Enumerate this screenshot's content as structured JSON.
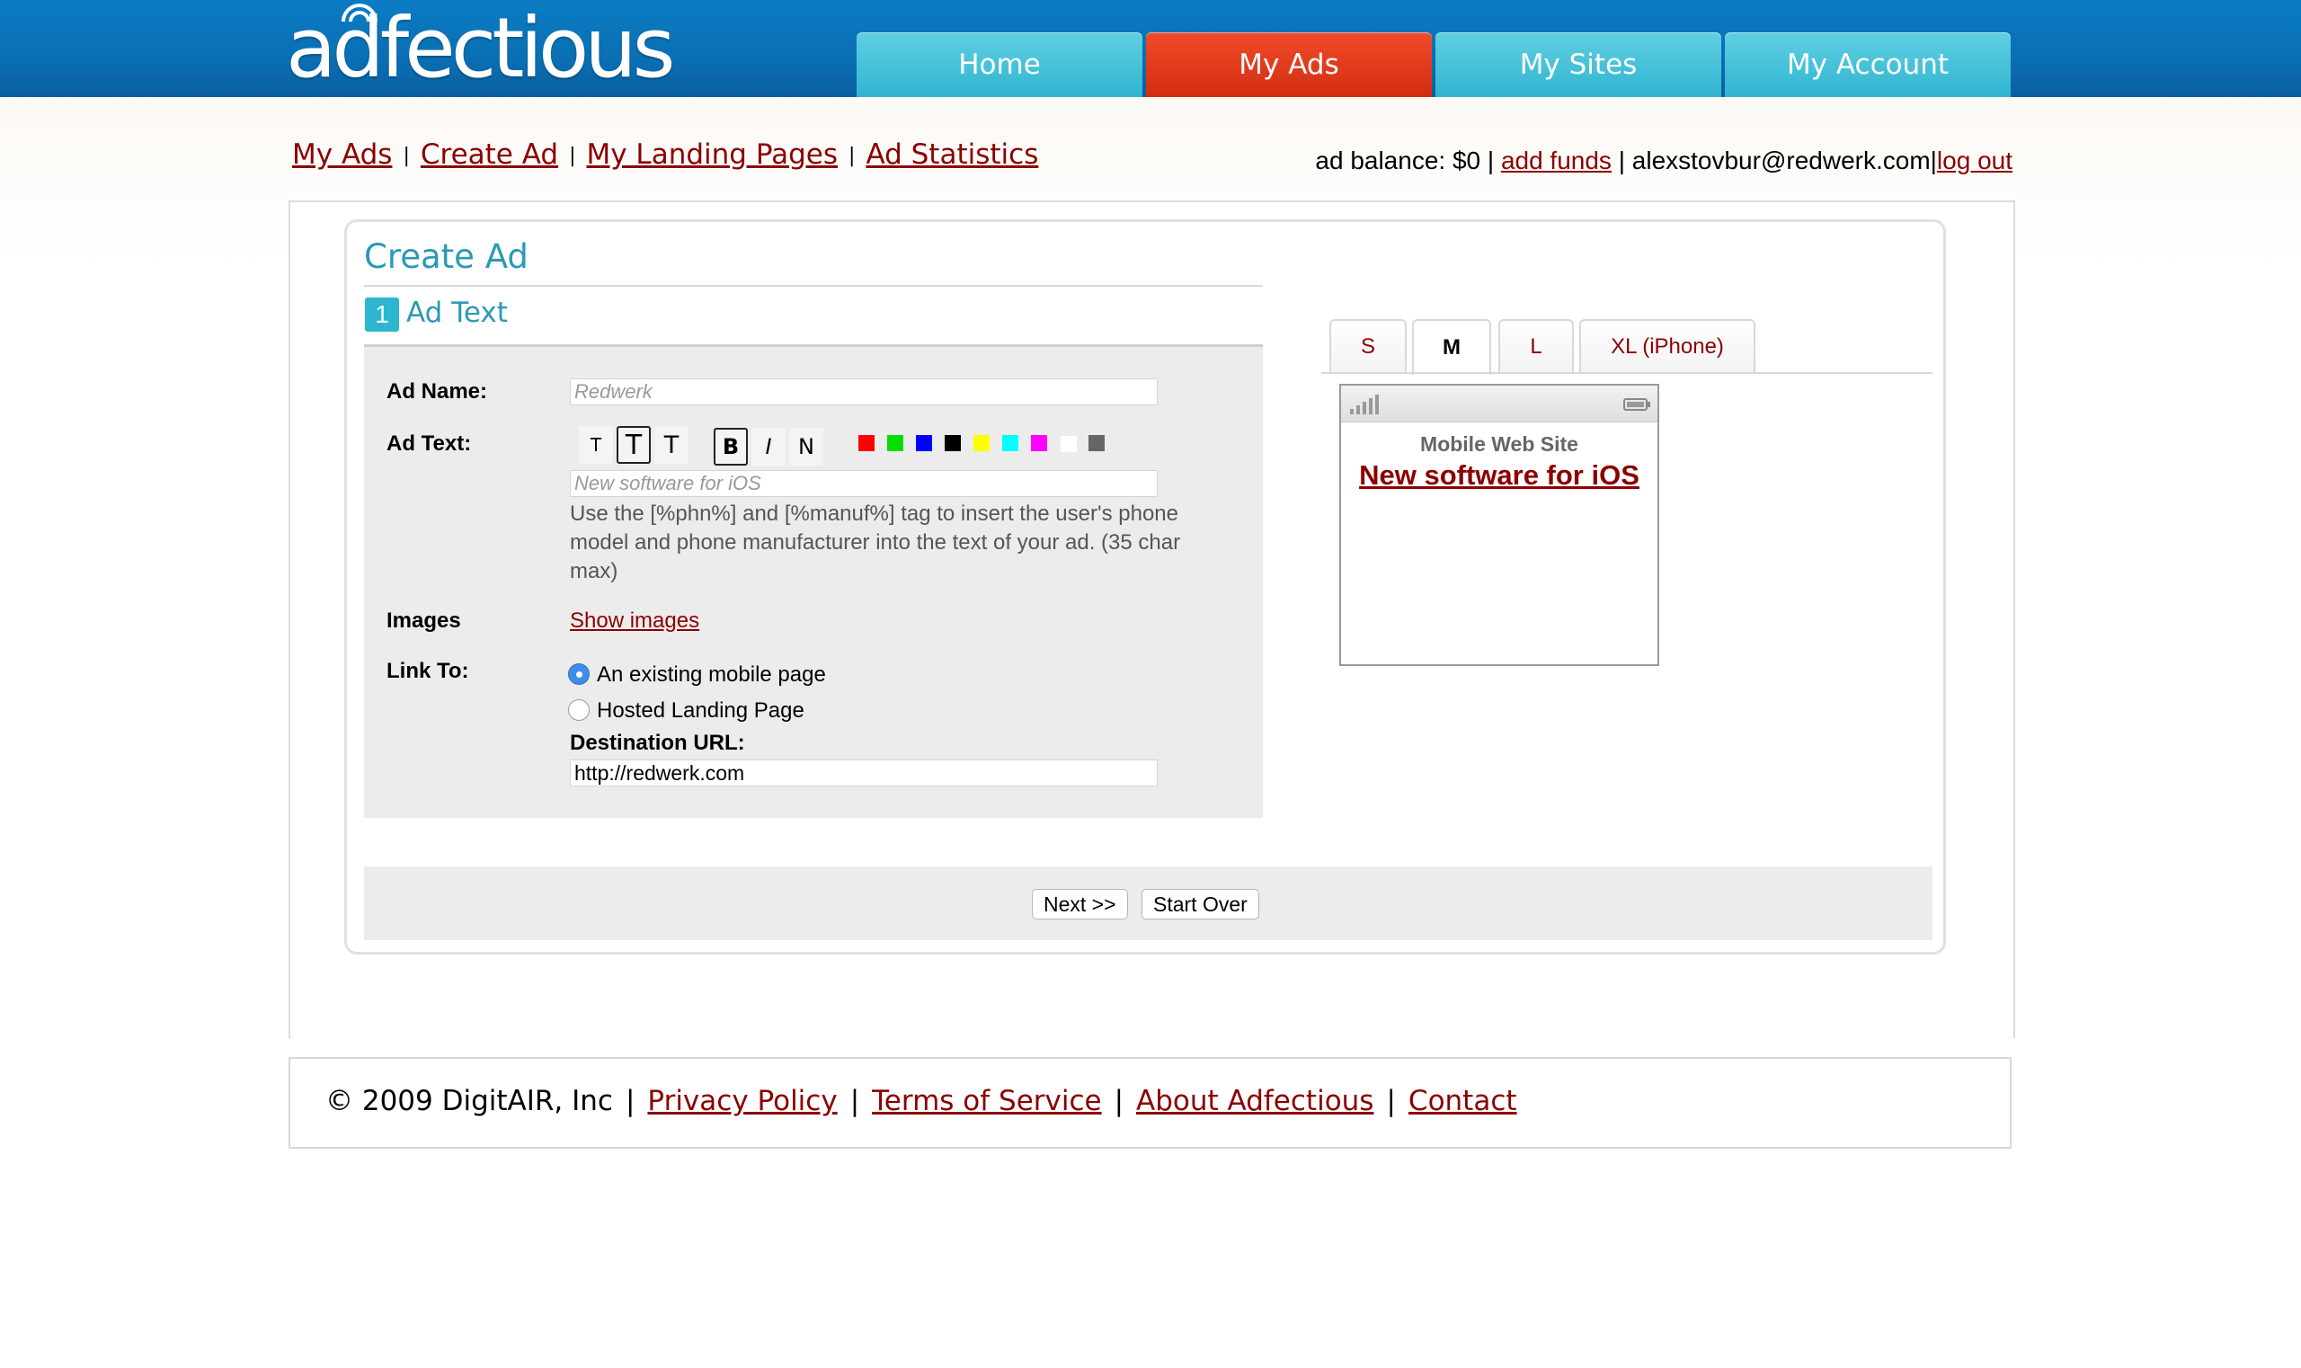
{
  "header": {
    "logo_text": "adfectious",
    "nav": [
      {
        "label": "Home",
        "active": false
      },
      {
        "label": "My Ads",
        "active": true
      },
      {
        "label": "My Sites",
        "active": false
      },
      {
        "label": "My Account",
        "active": false
      }
    ]
  },
  "subnav": {
    "my_ads": "My Ads",
    "create_ad": "Create Ad",
    "landing_pages": "My Landing Pages",
    "ad_statistics": "Ad Statistics",
    "separator": "|"
  },
  "account": {
    "balance_text": "ad balance: $0 |",
    "add_funds": "add funds",
    "email_text": "| alexstovbur@redwerk.com|",
    "log_out": "log out"
  },
  "form": {
    "title": "Create Ad",
    "step_number": "1",
    "step_label": "Ad Text",
    "ad_name_label": "Ad Name:",
    "ad_name_placeholder": "Redwerk",
    "ad_text_label": "Ad Text:",
    "ad_text_placeholder": "New software for iOS",
    "toolbar": {
      "small": "T",
      "medium": "T",
      "large": "T",
      "bold": "B",
      "italic": "I",
      "normal": "N"
    },
    "colors": [
      "#ff0000",
      "#00e000",
      "#0000ff",
      "#000000",
      "#ffff00",
      "#00ffff",
      "#ff00ff",
      "#ffffff",
      "#666666"
    ],
    "help_text": "Use the [%phn%] and [%manuf%] tag to insert the user's phone model and phone manufacturer into the text of your ad. (35 char max)",
    "images_label": "Images",
    "show_images": "Show images",
    "link_to_label": "Link To:",
    "option_existing": "An existing mobile page",
    "option_hosted": "Hosted Landing Page",
    "selected_option": "existing",
    "destination_label": "Destination URL:",
    "destination_value": "http://redwerk.com"
  },
  "preview": {
    "tabs": [
      {
        "label": "S",
        "active": false
      },
      {
        "label": "M",
        "active": true
      },
      {
        "label": "L",
        "active": false
      },
      {
        "label": "XL (iPhone)",
        "active": false
      }
    ],
    "site_label": "Mobile Web Site",
    "ad_text": "New software for iOS"
  },
  "buttons": {
    "next": "Next >>",
    "start_over": "Start Over"
  },
  "footer": {
    "copyright": "© 2009 DigitAIR, Inc",
    "privacy": "Privacy Policy",
    "terms": "Terms of Service",
    "about": "About Adfectious",
    "contact": "Contact",
    "separator": "|"
  }
}
